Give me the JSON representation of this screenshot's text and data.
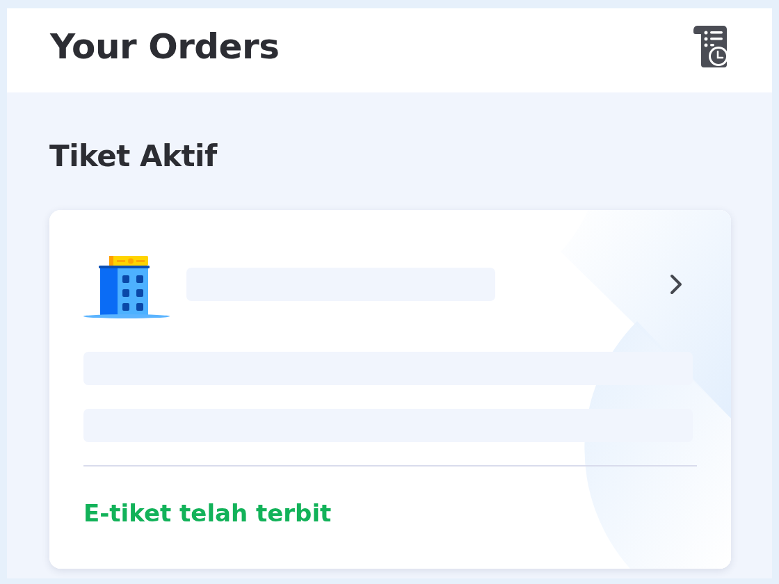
{
  "header": {
    "title": "Your Orders"
  },
  "section": {
    "title": "Tiket Aktif"
  },
  "orders": [
    {
      "status": "E-tiket telah terbit"
    }
  ]
}
